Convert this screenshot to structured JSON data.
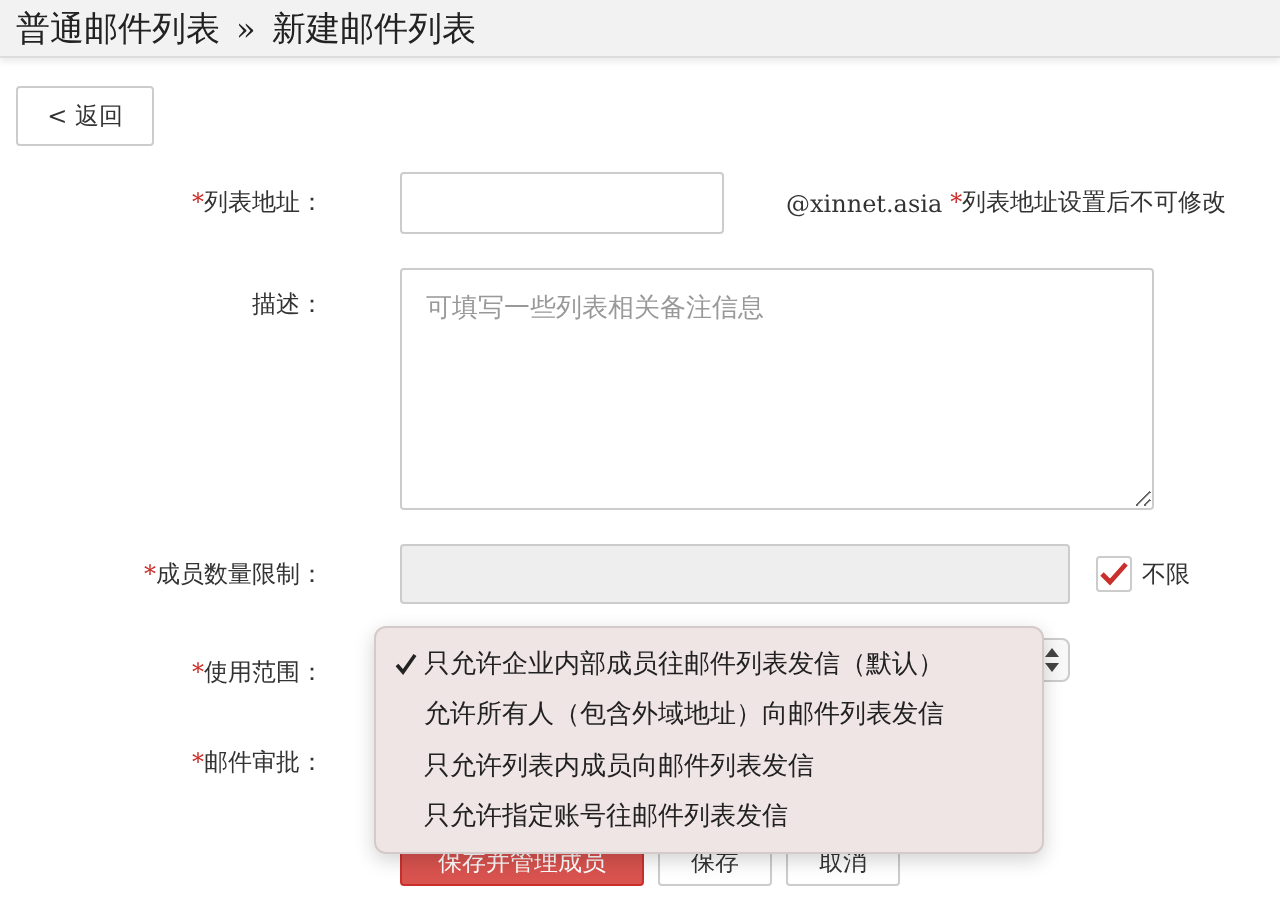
{
  "header": {
    "breadcrumb": [
      "普通邮件列表",
      "新建邮件列表"
    ],
    "separator": "»"
  },
  "back_button": {
    "label": "< 返回"
  },
  "form": {
    "rows": [
      {
        "kind": "text",
        "mark": "*",
        "label": "列表地址：",
        "suffix": "@xinnet.asia",
        "note_mark": "*",
        "note": "列表地址设置后不可修改"
      },
      {
        "kind": "textarea",
        "label": "描述：",
        "placeholder": "可填写一些列表相关备注信息"
      },
      {
        "kind": "limit",
        "mark": "*",
        "label": "成员数量限制：",
        "disabled": true,
        "checkbox": {
          "label": "不限",
          "checked": true
        }
      },
      {
        "kind": "select",
        "mark": "*",
        "label": "使用范围："
      },
      {
        "kind": "blank",
        "mark": "*",
        "label": "邮件审批："
      }
    ]
  },
  "buttons": [
    {
      "kind": "primary",
      "label": "保存并管理成员"
    },
    {
      "kind": "default",
      "label": "保存"
    },
    {
      "kind": "default",
      "label": "取消"
    }
  ],
  "dropdown": {
    "options": [
      {
        "label": "只允许企业内部成员往邮件列表发信（默认）",
        "selected": true
      },
      {
        "label": "允许所有人（包含外域地址）向邮件列表发信",
        "selected": false
      },
      {
        "label": "只允许列表内成员向邮件列表发信",
        "selected": false
      },
      {
        "label": "只允许指定账号往邮件列表发信",
        "selected": false
      }
    ]
  }
}
